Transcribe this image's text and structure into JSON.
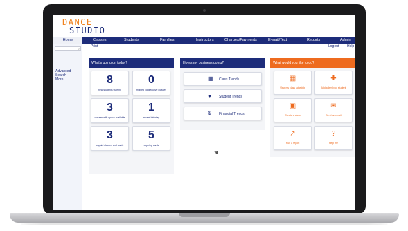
{
  "logo": {
    "line1": "DANCE",
    "line2": "STUDIO"
  },
  "sidebar": {
    "home_label": "Home",
    "search_placeholder": "",
    "links": [
      "Advanced",
      "Search",
      "More"
    ]
  },
  "nav": {
    "items": [
      "Classes",
      "Students",
      "Families",
      "Instructors",
      "Charges/Payments",
      "E-mail/Text",
      "Reports",
      "Admin"
    ]
  },
  "subbar": {
    "print": "Print",
    "logout": "Logout",
    "help": "Help"
  },
  "panels": {
    "today": {
      "title": "What's going on today?",
      "stats": [
        {
          "value": "8",
          "label": "new students starting"
        },
        {
          "value": "0",
          "label": "missed consecutive classes"
        },
        {
          "value": "3",
          "label": "classes with space available"
        },
        {
          "value": "1",
          "label": "recent birthday"
        },
        {
          "value": "3",
          "label": "unpaid classes and cards"
        },
        {
          "value": "5",
          "label": "expiring cards"
        }
      ]
    },
    "business": {
      "title": "How's my business doing?",
      "trends": [
        {
          "icon": "calendar-icon",
          "glyph": "▦",
          "label": "Class Trends"
        },
        {
          "icon": "person-icon",
          "glyph": "●",
          "label": "Student Trends"
        },
        {
          "icon": "dollar-icon",
          "glyph": "$",
          "label": "Financial Trends"
        }
      ]
    },
    "actions": {
      "title": "What would you like to do?",
      "items": [
        {
          "icon": "calendar-icon",
          "glyph": "▦",
          "label": "View my class schedule"
        },
        {
          "icon": "add-user-icon",
          "glyph": "✚",
          "label": "Add a family or student"
        },
        {
          "icon": "calendar-add-icon",
          "glyph": "▣",
          "label": "Create a class"
        },
        {
          "icon": "envelope-icon",
          "glyph": "✉",
          "label": "Send an email"
        },
        {
          "icon": "chart-icon",
          "glyph": "↗",
          "label": "Run a report"
        },
        {
          "icon": "help-icon",
          "glyph": "?",
          "label": "Help me"
        }
      ]
    }
  },
  "colors": {
    "navy": "#1d2c7a",
    "orange": "#ee6b1f",
    "logo_orange": "#f0821e"
  }
}
